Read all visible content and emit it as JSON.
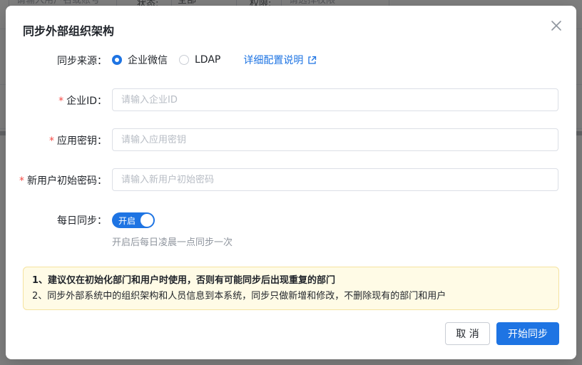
{
  "background": {
    "account_placeholder": "请输入用户名或账号",
    "status_label": "状态:",
    "status_value": "全部",
    "permission_label": "权限:",
    "permission_placeholder": "请选择权限"
  },
  "dialog": {
    "title": "同步外部组织架构",
    "close_icon": "close-icon",
    "sync_source": {
      "label": "同步来源",
      "options": [
        "企业微信",
        "LDAP"
      ],
      "selected": "企业微信",
      "config_link": "详细配置说明",
      "link_icon": "external-link-icon"
    },
    "corp_id": {
      "label": "企业ID",
      "required": true,
      "placeholder": "请输入企业ID",
      "value": ""
    },
    "app_secret": {
      "label": "应用密钥",
      "required": true,
      "placeholder": "请输入应用密钥",
      "value": ""
    },
    "initial_password": {
      "label": "新用户初始密码",
      "required": true,
      "placeholder": "请输入新用户初始密码",
      "value": ""
    },
    "daily_sync": {
      "label": "每日同步",
      "switch_text": "开启",
      "enabled": true,
      "hint": "开启后每日凌晨一点同步一次"
    },
    "notice": {
      "line1": "1、建议仅在初始化部门和用户时使用，否则有可能同步后出现重复的部门",
      "line2": "2、同步外部系统中的组织架构和人员信息到本系统，同步只做新增和修改，不删除现有的部门和用户"
    },
    "buttons": {
      "cancel": "取 消",
      "confirm": "开始同步"
    }
  },
  "colors": {
    "primary": "#1e74e3",
    "required": "#f54a45",
    "notice_bg": "#fffbe6",
    "notice_border": "#f5e3a0",
    "mask": "rgba(0,0,0,0.5)"
  }
}
